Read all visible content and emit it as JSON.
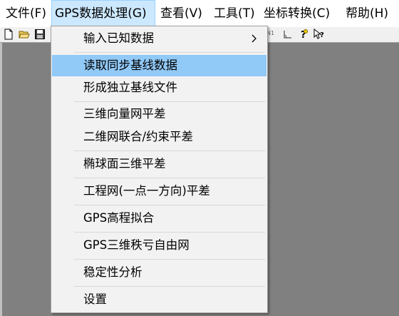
{
  "menubar": {
    "file": "文件(F)",
    "gps": "GPS数据处理(G)",
    "view": "查看(V)",
    "tools": "工具(T)",
    "coord": "坐标转换(C)",
    "help": "帮助(H)"
  },
  "toolbar": {
    "n1_label": "N1"
  },
  "dropdown": {
    "items": [
      {
        "label": "输入已知数据",
        "has_submenu": true
      },
      {
        "label": "读取同步基线数据",
        "highlighted": true
      },
      {
        "label": "形成独立基线文件"
      },
      {
        "label": "三维向量网平差"
      },
      {
        "label": "二维网联合/约束平差"
      },
      {
        "label": "椭球面三维平差"
      },
      {
        "label": "工程网(一点一方向)平差"
      },
      {
        "label": "GPS高程拟合"
      },
      {
        "label": "GPS三维秩亏自由网"
      },
      {
        "label": "稳定性分析"
      },
      {
        "label": "设置"
      }
    ]
  },
  "colors": {
    "highlight": "#91c9f7",
    "active_menu": "#cce8ff",
    "client_bg": "#808080"
  }
}
